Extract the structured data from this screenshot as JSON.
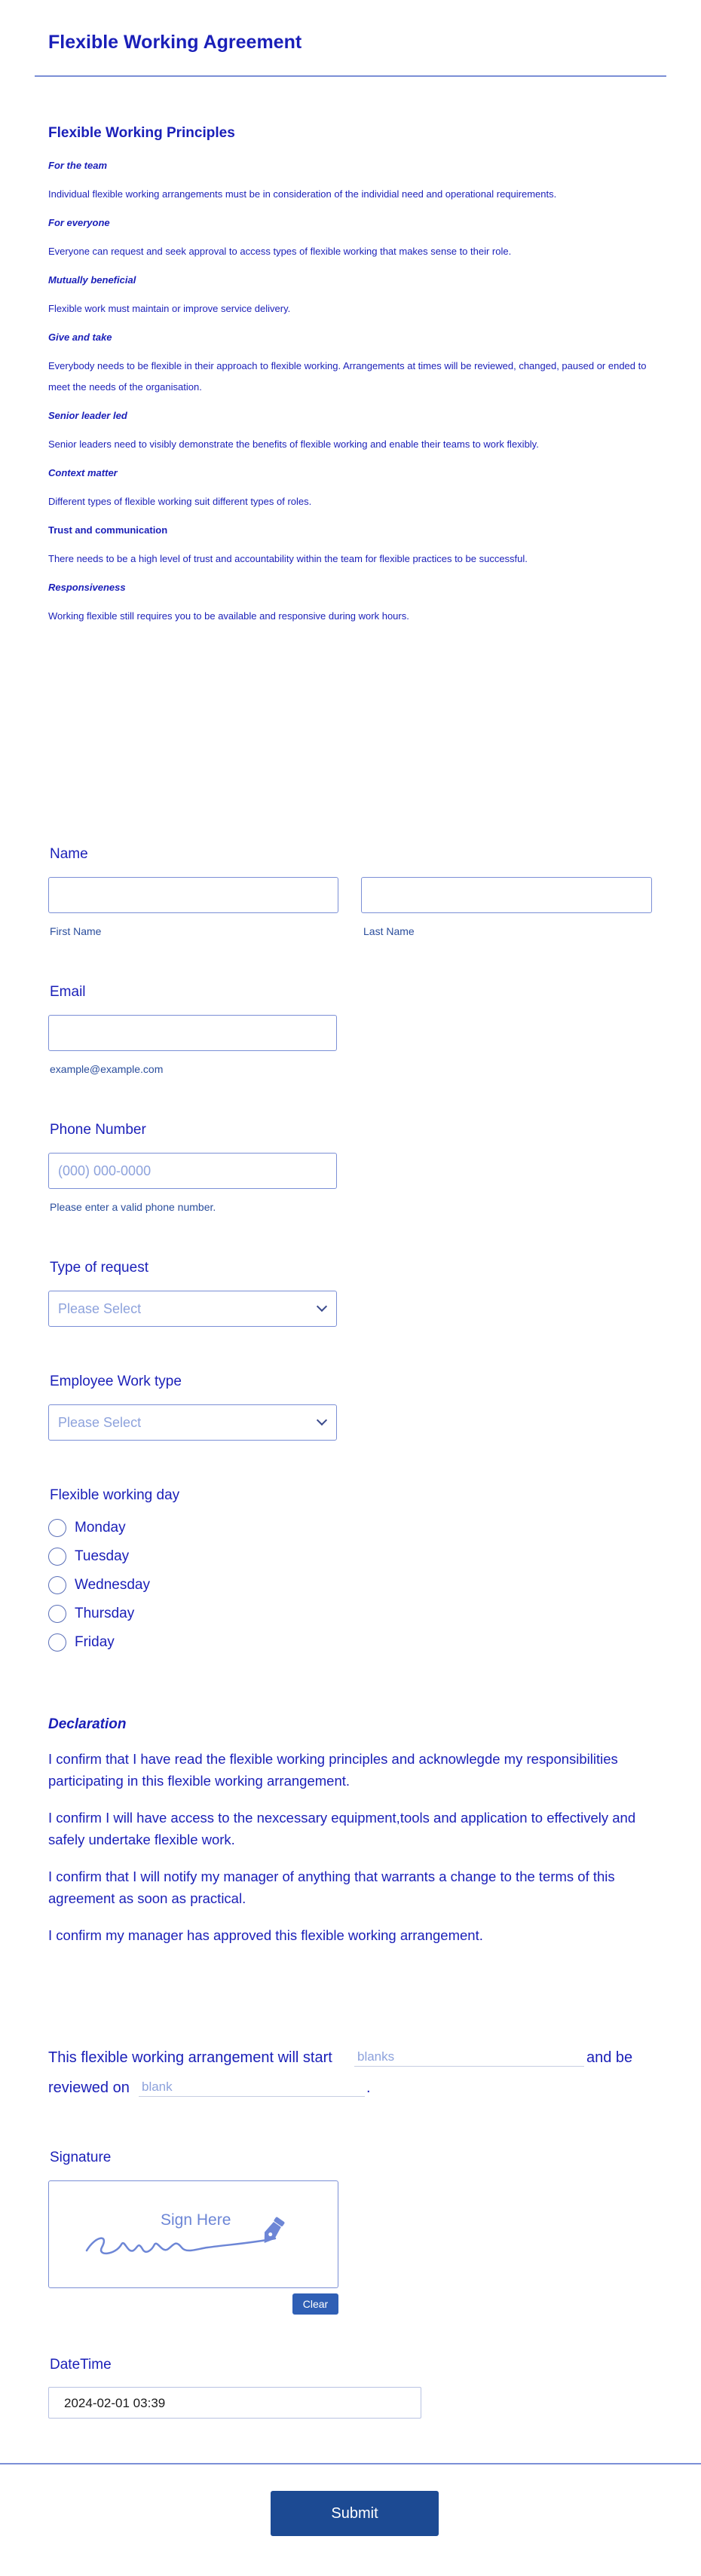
{
  "header": {
    "title": "Flexible Working Agreement"
  },
  "principles": {
    "title": "Flexible Working Principles",
    "items": [
      {
        "heading": "For the team",
        "text": "Individual flexible working arrangements must be in consideration of the individial need and operational requirements."
      },
      {
        "heading": "For everyone",
        "text": "Everyone can request and seek approval to access types of flexible working that makes sense to their role."
      },
      {
        "heading": "Mutually beneficial",
        "text": "Flexible work must maintain or improve service delivery."
      },
      {
        "heading": "Give and take",
        "text": "Everybody needs to be flexible in their approach to flexible working. Arrangements at times will be reviewed, changed, paused or ended to meet the needs of the organisation."
      },
      {
        "heading": "Senior leader led",
        "text": "Senior leaders need to visibly demonstrate the benefits of flexible working and enable their teams to work flexibly."
      },
      {
        "heading": "Context matter",
        "text": "Different types of flexible working suit different types of roles."
      },
      {
        "heading": "Trust and communication",
        "text": "There needs to be a high level of trust and accountability within the team for flexible practices to be successful."
      },
      {
        "heading": "Responsiveness",
        "text": "Working flexible still requires you to be available and responsive during work hours."
      }
    ]
  },
  "name": {
    "label": "Name",
    "first_value": "",
    "last_value": "",
    "first_sublabel": "First Name",
    "last_sublabel": "Last Name"
  },
  "email": {
    "label": "Email",
    "value": "",
    "sublabel": "example@example.com"
  },
  "phone": {
    "label": "Phone Number",
    "placeholder": "(000) 000-0000",
    "sublabel": "Please enter a valid phone number."
  },
  "request_type": {
    "label": "Type of request",
    "placeholder": "Please Select"
  },
  "work_type": {
    "label": "Employee Work type",
    "placeholder": "Please Select"
  },
  "working_day": {
    "label": "Flexible working day",
    "options": [
      "Monday",
      "Tuesday",
      "Wednesday",
      "Thursday",
      "Friday"
    ]
  },
  "declaration": {
    "title": "Declaration",
    "paragraphs": [
      "I confirm that I have read the flexible working principles and acknowlegde my responsibilities participating in this flexible working arrangement.",
      "I confirm I will have access to the nexcessary equipment,tools and application to effectively and safely undertake flexible work.",
      "I confirm that I will notify my manager of anything that warrants a change to the terms of this agreement as soon as practical.",
      "I confirm my manager has approved this flexible working arrangement."
    ]
  },
  "arrangement": {
    "part1": "This flexible working arrangement will start",
    "blank1": "blanks",
    "part2": "and be",
    "part3": "reviewed on",
    "blank2": "blank",
    "part4": "."
  },
  "signature": {
    "label": "Signature",
    "sign_here": "Sign Here",
    "clear_label": "Clear"
  },
  "datetime": {
    "label": "DateTime",
    "value": "2024-02-01 03:39"
  },
  "submit": {
    "label": "Submit"
  },
  "colors": {
    "accent": "#1a1fb8",
    "border": "#7b8fd6",
    "button": "#1c4a93",
    "clear_button": "#2f5fb5"
  }
}
